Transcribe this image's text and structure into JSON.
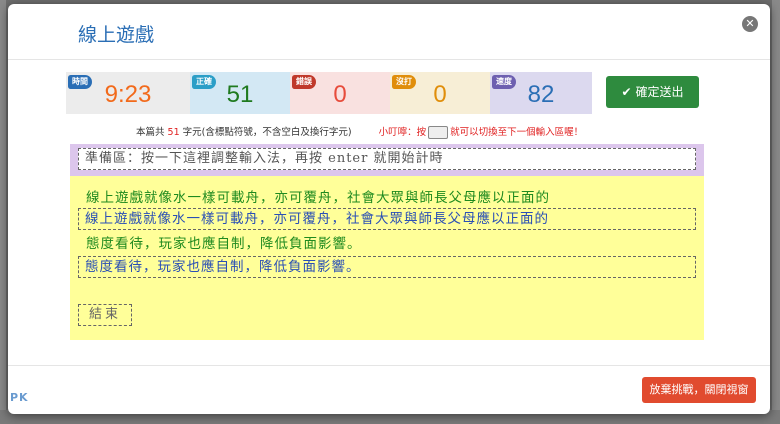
{
  "modal": {
    "title": "線上遊戲",
    "close_icon": "close-circle-icon"
  },
  "stats": {
    "time": {
      "label": "時間",
      "value": "9:23"
    },
    "correct": {
      "label": "正確",
      "value": "51"
    },
    "wrong": {
      "label": "錯誤",
      "value": "0"
    },
    "missed": {
      "label": "沒打",
      "value": "0"
    },
    "speed": {
      "label": "速度",
      "value": "82"
    }
  },
  "submit": {
    "label": "確定送出",
    "icon": "check-icon"
  },
  "info": {
    "prefix": "本篇共",
    "count": "51",
    "suffix": "字元(含標點符號，不含空白及換行字元)",
    "tip_prefix": "小叮嚀：按",
    "tip_suffix": "就可以切換至下一個輸入區喔！",
    "tip_icon": "keyboard-icon"
  },
  "prep": {
    "text": "準備區：按一下這裡調整輸入法，再按 enter 就開始計時"
  },
  "typing": {
    "source_lines": [
      "線上遊戲就像水一樣可載舟，亦可覆舟，社會大眾與師長父母應以正面的",
      "態度看待，玩家也應自制，降低負面影響。"
    ],
    "input_lines": [
      "線上遊戲就像水一樣可載舟，亦可覆舟，社會大眾與師長父母應以正面的",
      "態度看待，玩家也應自制，降低負面影響。"
    ],
    "end_label": "結束"
  },
  "footer": {
    "abandon_label": "放棄挑戰，關閉視窗",
    "watermark": "PK"
  },
  "colors": {
    "title": "#2a6eb5",
    "submit": "#2e8b3e",
    "abandon": "#e14b2f",
    "typing_bg": "#ffff99",
    "prep_bg": "#dcc6ec"
  }
}
